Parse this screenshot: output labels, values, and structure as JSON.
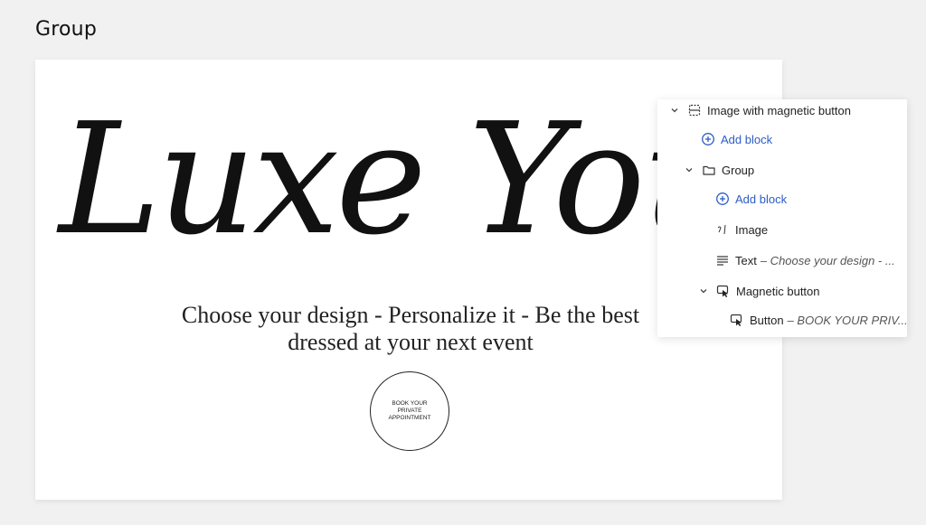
{
  "header": {
    "title": "Group"
  },
  "preview": {
    "hero_title": "Luxe You",
    "subtitle": "Choose your design - Personalize it - Be the best dressed at your next event",
    "button_text": "BOOK YOUR PRIVATE APPOINTMENT"
  },
  "tree": {
    "root_label": "Image with magnetic button",
    "add_block_1": "Add block",
    "group_label": "Group",
    "add_block_2": "Add block",
    "image_label": "Image",
    "text_label": "Text",
    "text_detail": "– Choose your design - ...",
    "magnetic_label": "Magnetic button",
    "button_label": "Button",
    "button_detail": "– BOOK YOUR PRIV..."
  },
  "colors": {
    "accent": "#2c5cc5",
    "background": "#f1f1f1",
    "panel": "#ffffff"
  }
}
